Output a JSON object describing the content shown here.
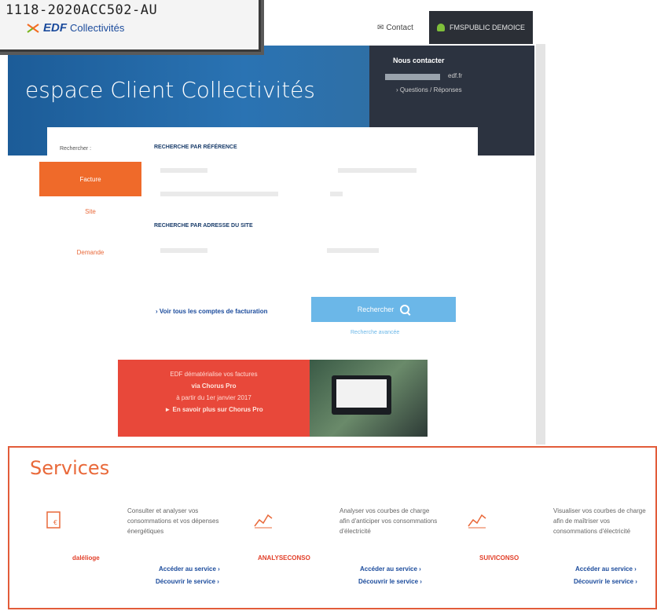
{
  "stamp": {
    "code": "1118-2020ACC502-AU",
    "brand": "EDF",
    "brand_sub": "Collectivités"
  },
  "header": {
    "contact": "Contact",
    "user": "FMSPUBLIC DEMOICE"
  },
  "banner": {
    "title": "espace Client Collectivités",
    "contact_heading": "Nous contacter",
    "contact_mail_suffix": "edf.fr",
    "faq": "› Questions / Réponses"
  },
  "search": {
    "sidebar_label": "Rechercher :",
    "tabs": [
      "Facture",
      "Site",
      "Demande"
    ],
    "section_ref": "RECHERCHE PAR RÉFÉRENCE",
    "section_addr": "RECHERCHE PAR ADRESSE DU SITE",
    "see_all": "› Voir tous les comptes de facturation",
    "button": "Rechercher",
    "advanced": "Recherche avancée"
  },
  "promo": {
    "line1": "EDF dématérialise vos factures",
    "line2": "via Chorus Pro",
    "line3": "à partir du 1er janvier 2017",
    "link": "► En savoir plus sur Chorus Pro"
  },
  "services": {
    "title": "Services",
    "items": [
      {
        "name": "dalélioge",
        "icon": "bill-icon",
        "desc": "Consulter et analyser vos consommations et vos dépenses énergétiques",
        "access": "Accéder au service ›",
        "discover": "Découvrir le service ›"
      },
      {
        "name": "ANALYSECONSO",
        "icon": "chart-icon",
        "desc": "Analyser vos courbes de charge afin d'anticiper vos consommations d'électricité",
        "access": "Accéder au service ›",
        "discover": "Découvrir le service ›"
      },
      {
        "name": "SUIVICONSO",
        "icon": "chart-icon",
        "desc": "Visualiser vos courbes de charge afin de maîtriser vos consommations d'électricité",
        "access": "Accéder au service ›",
        "discover": "Découvrir le service ›"
      }
    ]
  },
  "colors": {
    "accent": "#ef6a2a",
    "brand_blue": "#1b4b9c",
    "banner": "#2a73b3"
  }
}
